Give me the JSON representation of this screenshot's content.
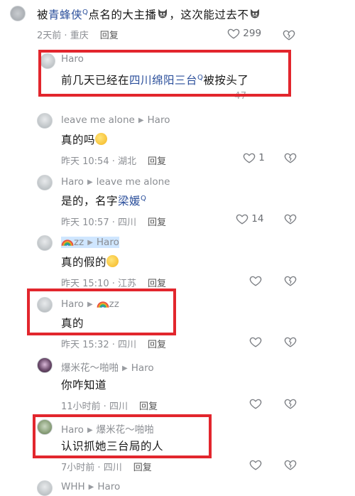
{
  "comments": [
    {
      "content_prefix": "被",
      "content_link": "青蜂侠",
      "content_middle": "点名的大主播",
      "content_suffix": "，这次能过去不",
      "time": "2天前",
      "location": "重庆",
      "reply": "回复",
      "likes": "299"
    },
    {
      "name": "Haro",
      "content_prefix": "前几天已经在",
      "content_link": "四川绵阳三台",
      "content_suffix": "被按头了",
      "likes": "47"
    },
    {
      "name": "leave  me alone",
      "reply_to": "Haro",
      "content": "真的吗",
      "time": "昨天 10:54",
      "location": "湖北",
      "reply": "回复",
      "likes": "1"
    },
    {
      "name": "Haro",
      "reply_to": "leave  me alone",
      "content_prefix": "是的，名字",
      "content_link": "梁媛",
      "time": "昨天 10:57",
      "location": "四川",
      "reply": "回复",
      "likes": "14"
    },
    {
      "name": "zz",
      "reply_to": "Haro",
      "content": "真的假的",
      "time": "昨天 15:10",
      "location": "江苏",
      "reply": "回复"
    },
    {
      "name": "Haro",
      "reply_to": "zz",
      "content": "真的",
      "time": "昨天 15:32",
      "location": "四川",
      "reply": "回复"
    },
    {
      "name": "爆米花～啪啪",
      "reply_to": "Haro",
      "content": "你咋知道",
      "time": "11小时前",
      "location": "四川",
      "reply": "回复"
    },
    {
      "name": "Haro",
      "reply_to": "爆米花～啪啪",
      "content": "认识抓她三台局的人",
      "time": "7小时前",
      "location": "四川",
      "reply": "回复"
    },
    {
      "name": "WHH",
      "reply_to": "Haro"
    }
  ],
  "colors": {
    "highlight_box": "#e2262d",
    "link": "#2b4f9b",
    "muted": "#8a8d92"
  },
  "icons": {
    "like": "heart-outline-icon",
    "dislike": "broken-heart-icon",
    "search_hint": "search-icon",
    "reply_arrow": "triangle-right-icon",
    "emoji": "laughing-emoji-icon",
    "rainbow": "rainbow-emoji-icon"
  }
}
